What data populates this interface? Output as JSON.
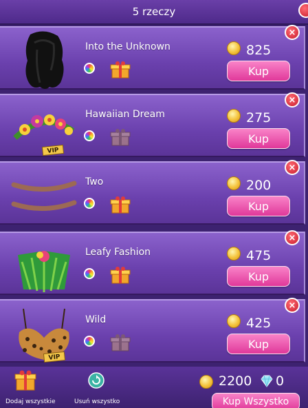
{
  "header": {
    "title": "5 rzeczy"
  },
  "items": [
    {
      "name": "Into the Unknown",
      "price": "825",
      "buy_label": "Kup",
      "remove_label": "×",
      "vip": false,
      "thumb": "hair"
    },
    {
      "name": "Hawaiian Dream",
      "price": "275",
      "buy_label": "Kup",
      "remove_label": "×",
      "vip": true,
      "thumb": "flowers"
    },
    {
      "name": "Two",
      "price": "200",
      "buy_label": "Kup",
      "remove_label": "×",
      "vip": false,
      "thumb": "lines"
    },
    {
      "name": "Leafy Fashion",
      "price": "475",
      "buy_label": "Kup",
      "remove_label": "×",
      "vip": false,
      "thumb": "leaves"
    },
    {
      "name": "Wild",
      "price": "425",
      "buy_label": "Kup",
      "remove_label": "×",
      "vip": true,
      "thumb": "leopard"
    }
  ],
  "vip_label": "VIP",
  "footer": {
    "add_all_label": "Dodaj wszystkie",
    "remove_all_label": "Usuń wszystko",
    "total_coins": "2200",
    "total_gems": "0",
    "buy_all_label": "Kup Wszystko"
  },
  "icons": {
    "coin": "coin-icon",
    "gem": "diamond-icon",
    "gift": "gift-icon",
    "color": "color-wheel-icon",
    "remove": "close-icon",
    "refresh": "refresh-icon"
  },
  "colors": {
    "background": "#3d2270",
    "item_panel": "#7a50bc",
    "buy_button": "#e84aa8",
    "remove_button": "#d62433",
    "coin": "#f4c23a"
  }
}
